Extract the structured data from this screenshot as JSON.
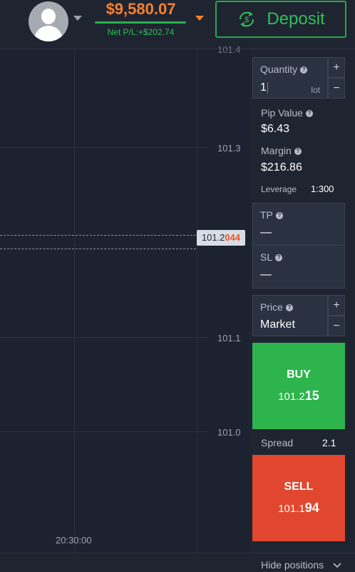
{
  "header": {
    "balance": "$9,580.07",
    "net_pl": "Net P/L:+$202.74",
    "deposit_label": "Deposit"
  },
  "colors": {
    "accent_orange": "#f6812f",
    "green": "#2db44c",
    "red": "#e1472f",
    "bg": "#1f2431"
  },
  "chart": {
    "y_ticks": [
      "101.3",
      "101.1",
      "101.0"
    ],
    "y_tick_top_partial": "101.4",
    "x_ticks": [
      "20:30:00"
    ],
    "current_price_prefix": "101.2",
    "current_price_suffix": "044"
  },
  "order": {
    "quantity_label": "Quantity",
    "quantity_value": "1",
    "quantity_unit": "lot",
    "pip_value_label": "Pip Value",
    "pip_value": "$6.43",
    "margin_label": "Margin",
    "margin_value": "$216.86",
    "leverage_label": "Leverage",
    "leverage_value": "1:300",
    "tp_label": "TP",
    "tp_value": "—",
    "sl_label": "SL",
    "sl_value": "—",
    "price_label": "Price",
    "price_value": "Market",
    "buy_label": "BUY",
    "buy_price_prefix": "101.2",
    "buy_price_suffix": "15",
    "spread_label": "Spread",
    "spread_value": "2.1",
    "sell_label": "SELL",
    "sell_price_prefix": "101.1",
    "sell_price_suffix": "94"
  },
  "footer": {
    "hide_positions_label": "Hide positions"
  },
  "icons": [
    "avatar-icon",
    "dropdown-caret-icon",
    "deposit-currency-icon",
    "help-icon",
    "plus-icon",
    "minus-icon",
    "chevron-down-icon"
  ]
}
